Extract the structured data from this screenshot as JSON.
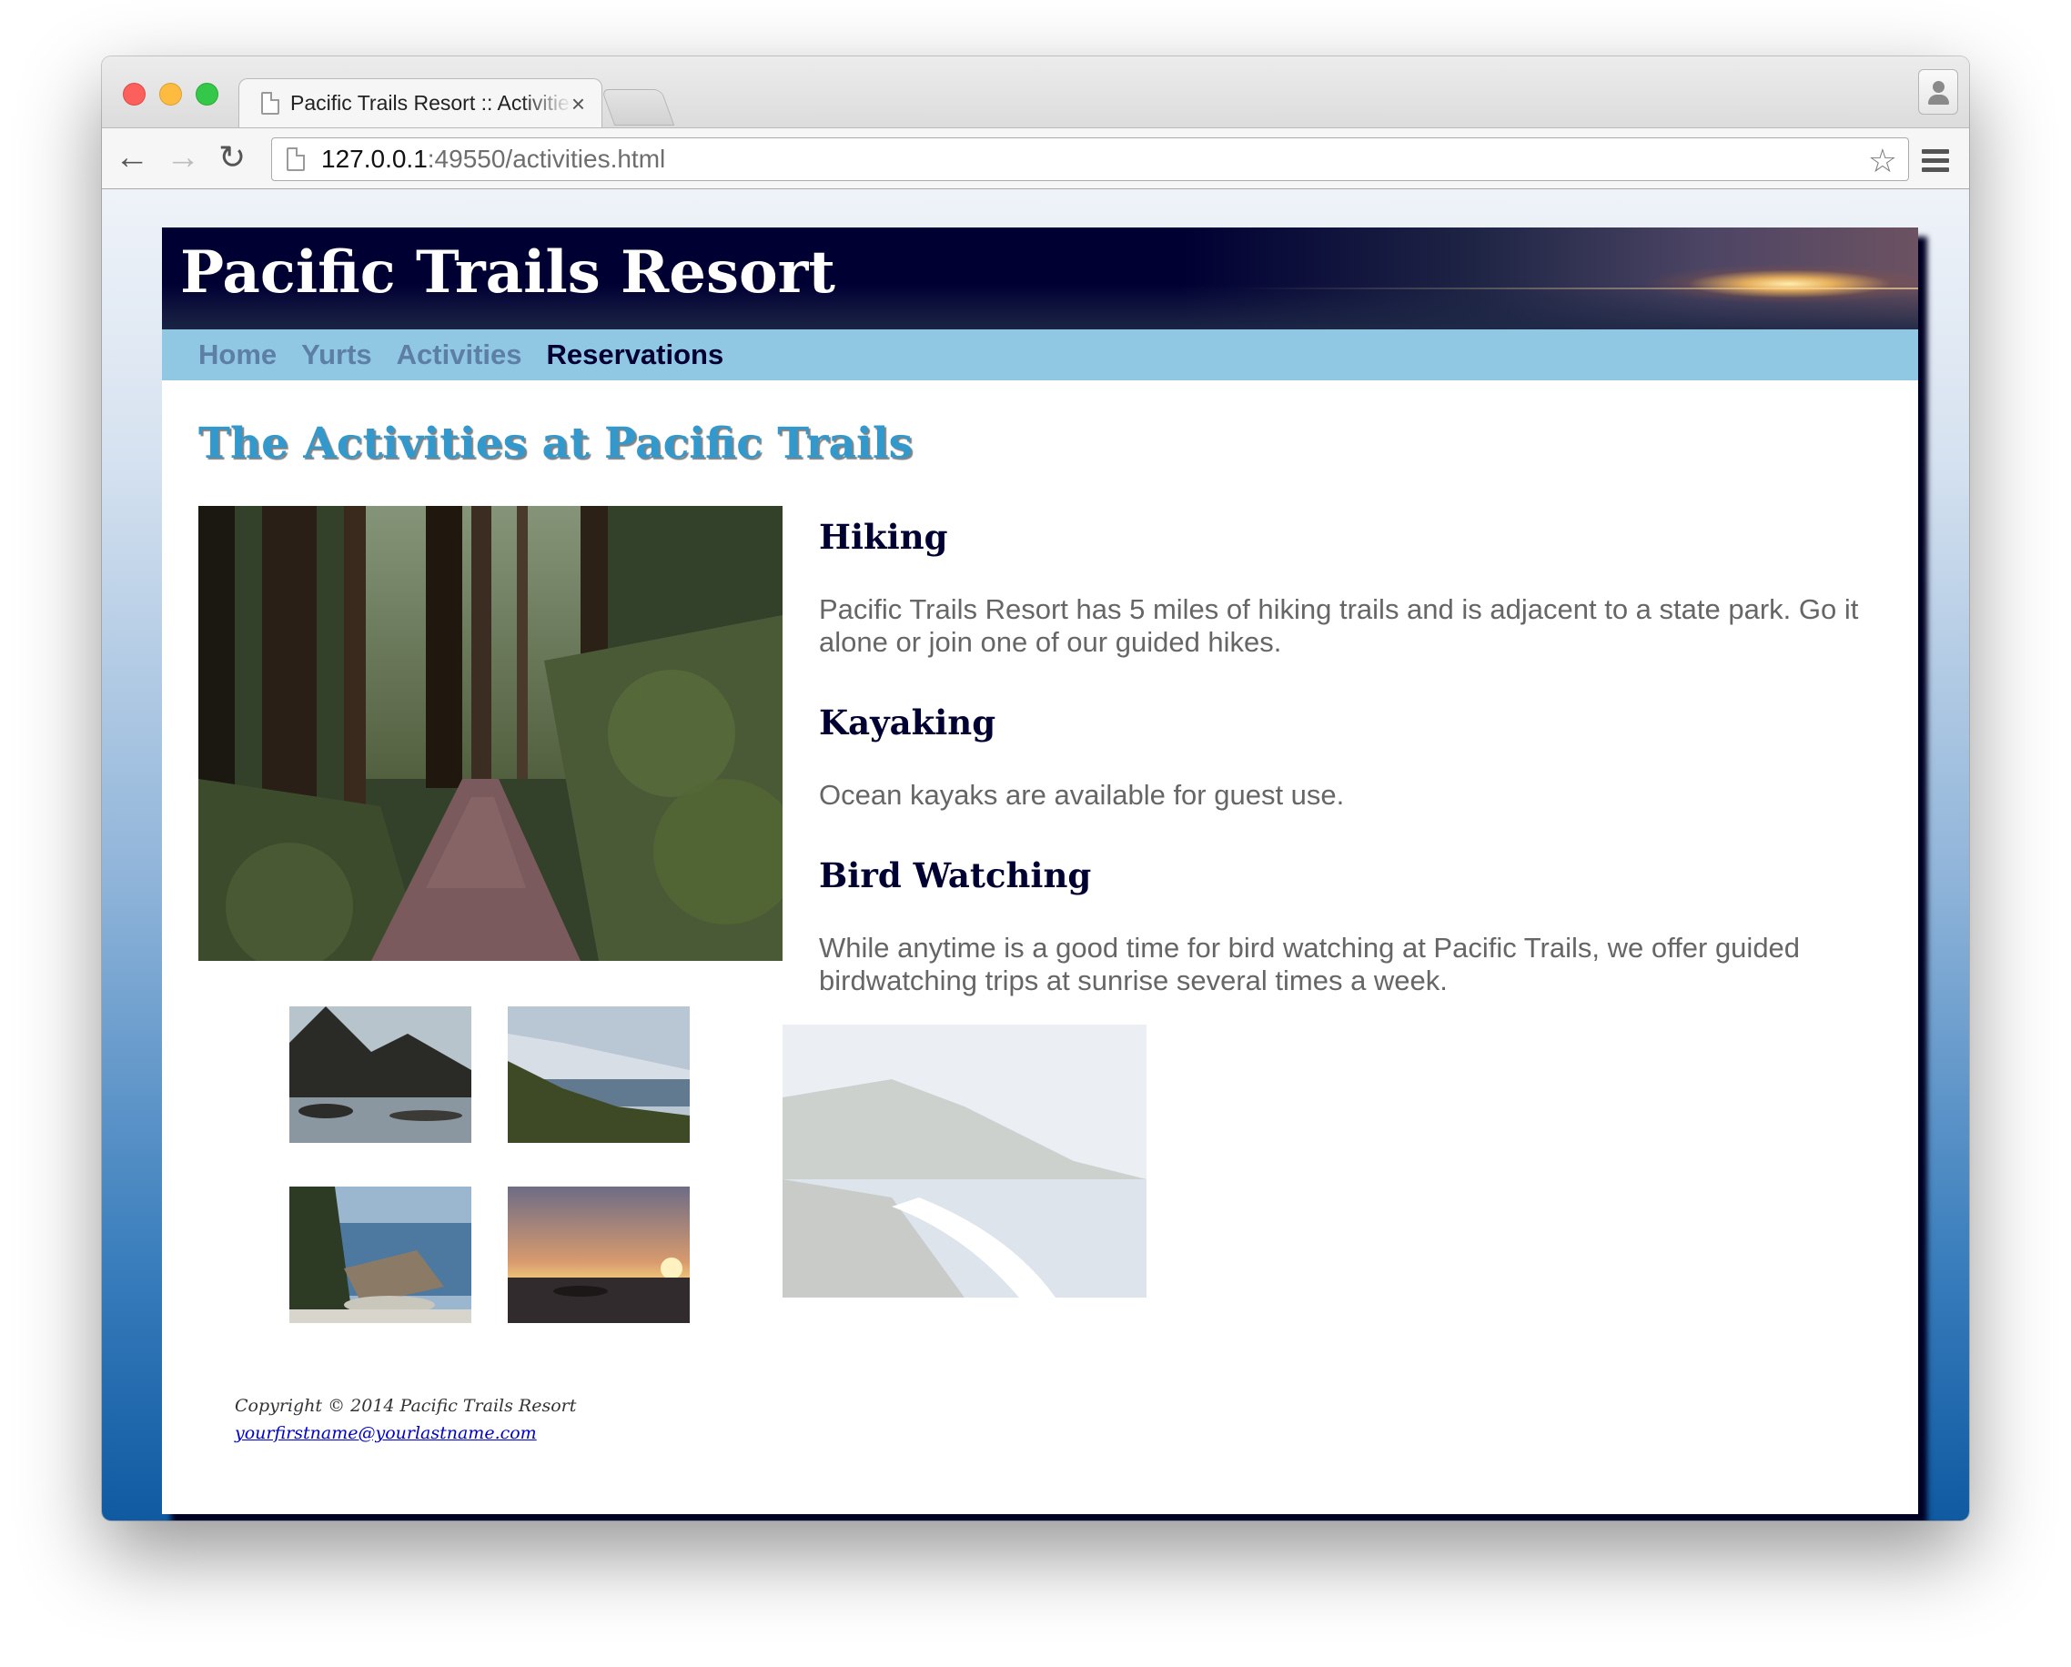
{
  "browser": {
    "tab_title": "Pacific Trails Resort :: Activities",
    "tab_close": "×",
    "url_host": "127.0.0.1",
    "url_rest": ":49550/activities.html",
    "back_glyph": "←",
    "forward_glyph": "→",
    "reload_glyph": "↻",
    "star_glyph": "☆"
  },
  "site": {
    "title": "Pacific Trails Resort",
    "nav": [
      {
        "label": "Home"
      },
      {
        "label": "Yurts"
      },
      {
        "label": "Activities"
      },
      {
        "label": "Reservations"
      }
    ]
  },
  "main": {
    "heading": "The Activities at Pacific Trails",
    "sections": [
      {
        "title": "Hiking",
        "text": "Pacific Trails Resort has 5 miles of hiking trails and is adjacent to a state park. Go it alone or join one of our guided hikes."
      },
      {
        "title": "Kayaking",
        "text": "Ocean kayaks are available for guest use."
      },
      {
        "title": "Bird Watching",
        "text": "While anytime is a good time for bird watching at Pacific Trails, we offer guided birdwatching trips at sunrise several times a week."
      }
    ]
  },
  "footer": {
    "copyright": "Copyright © 2014 Pacific Trails Resort",
    "email": "yourfirstname@yourlastname.com"
  },
  "colors": {
    "header_bg": "#000033",
    "nav_bg": "#90c7e3",
    "heading": "#3399cc",
    "subheading": "#000033",
    "body_text": "#666666"
  }
}
